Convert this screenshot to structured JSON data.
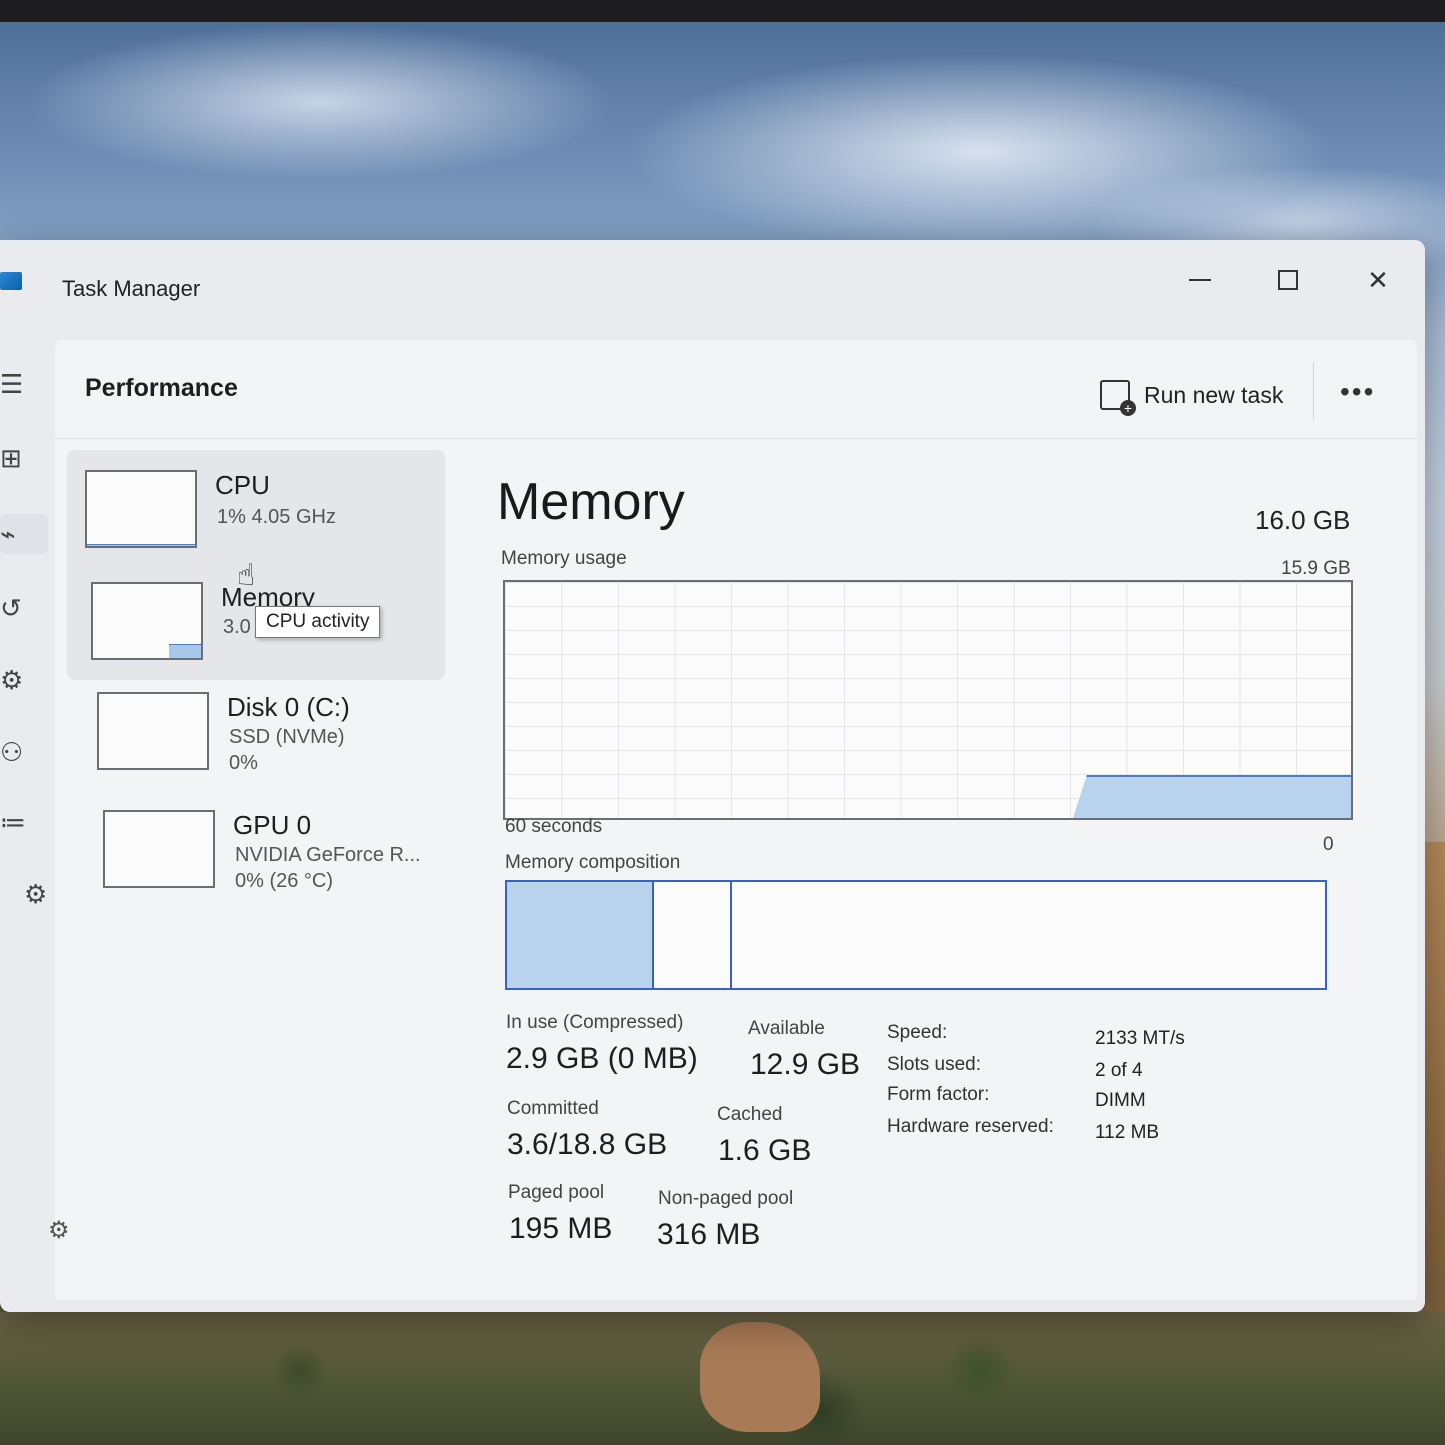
{
  "window": {
    "title": "Task Manager",
    "minimize_label": "—",
    "close_label": "✕"
  },
  "rail": {
    "items": [
      {
        "name": "hamburger-menu-icon",
        "glyph": "☰"
      },
      {
        "name": "processes-icon",
        "glyph": "⊞"
      },
      {
        "name": "performance-icon",
        "glyph": "⌁"
      },
      {
        "name": "app-history-icon",
        "glyph": "↺"
      },
      {
        "name": "startup-apps-icon",
        "glyph": "⚙"
      },
      {
        "name": "users-icon",
        "glyph": "⚇"
      },
      {
        "name": "details-icon",
        "glyph": "≔"
      },
      {
        "name": "services-icon",
        "glyph": "⚙"
      }
    ],
    "settings_glyph": "⚙"
  },
  "header": {
    "title": "Performance",
    "run_new_task": "Run new task",
    "more": "•••"
  },
  "devices": [
    {
      "name": "CPU",
      "line1": "1% 4.05 GHz",
      "line2": "",
      "usage_fraction": 0.01
    },
    {
      "name": "Memory",
      "line1": "3.0",
      "line2": "",
      "usage_fraction": 0.18
    },
    {
      "name": "Disk 0 (C:)",
      "line1": "SSD (NVMe)",
      "line2": "0%",
      "usage_fraction": 0.0
    },
    {
      "name": "GPU 0",
      "line1": "NVIDIA GeForce R...",
      "line2": "0% (26 °C)",
      "usage_fraction": 0.0
    }
  ],
  "tooltip": "CPU activity",
  "memory": {
    "title": "Memory",
    "total": "16.0 GB",
    "usage_label": "Memory usage",
    "usage_max": "15.9 GB",
    "axis_left": "60 seconds",
    "axis_right": "0",
    "composition_label": "Memory composition",
    "usage_fraction": 0.18,
    "composition": {
      "in_use_fraction": 0.18,
      "modified_fraction": 0.095
    },
    "stats": {
      "in_use_label": "In use (Compressed)",
      "in_use_value": "2.9 GB (0 MB)",
      "available_label": "Available",
      "available_value": "12.9 GB",
      "committed_label": "Committed",
      "committed_value": "3.6/18.8 GB",
      "cached_label": "Cached",
      "cached_value": "1.6 GB",
      "paged_label": "Paged pool",
      "paged_value": "195 MB",
      "nonpaged_label": "Non-paged pool",
      "nonpaged_value": "316 MB"
    },
    "specs": [
      {
        "label": "Speed:",
        "value": "2133 MT/s"
      },
      {
        "label": "Slots used:",
        "value": "2 of 4"
      },
      {
        "label": "Form factor:",
        "value": "DIMM"
      },
      {
        "label": "Hardware reserved:",
        "value": "112 MB"
      }
    ]
  },
  "colors": {
    "accent": "#4a7fc1",
    "graph_fill": "#b9d2ee",
    "composition_border": "#3a5fc8"
  }
}
